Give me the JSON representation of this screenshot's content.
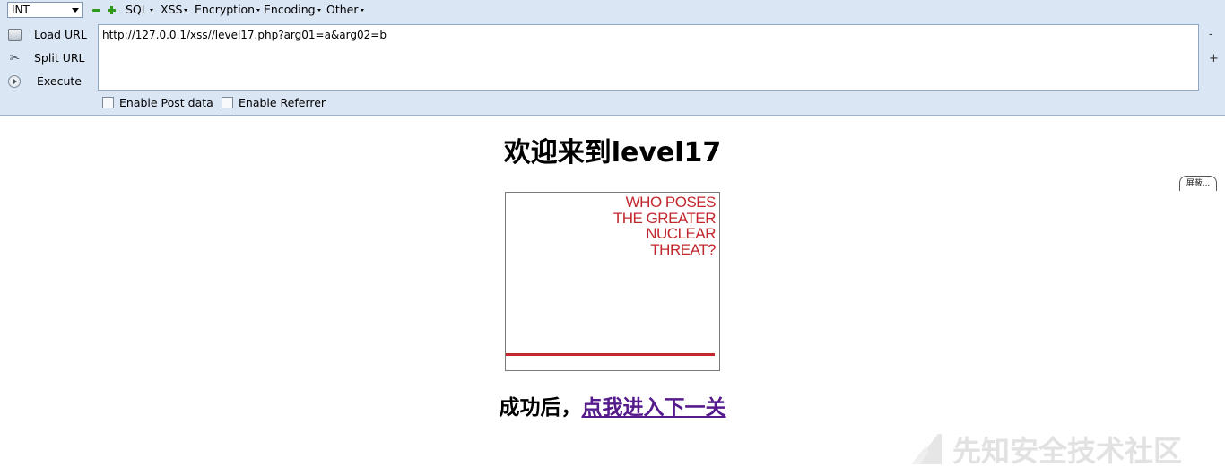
{
  "hackbar": {
    "int_select": "INT",
    "menus": [
      "SQL",
      "XSS",
      "Encryption",
      "Encoding",
      "Other"
    ],
    "load_url": "Load URL",
    "split_url": "Split URL",
    "execute": "Execute",
    "url": "http://127.0.0.1/xss//level17.php?arg01=a&arg02=b",
    "minus_mark": "-",
    "plus_mark": "+",
    "enable_post": "Enable Post data",
    "enable_referrer": "Enable Referrer"
  },
  "page": {
    "title": "欢迎来到level17",
    "embed_text": [
      "WHO POSES",
      "THE GREATER",
      "NUCLEAR",
      "THREAT?"
    ],
    "footer_prefix": "成功后，",
    "footer_link": "点我进入下一关",
    "side_tab": "屏蔽..."
  },
  "watermark": {
    "text": "先知安全技术社区"
  },
  "colors": {
    "toolbar_bg": "#dbe6f4",
    "embed_red": "#c1272d",
    "link_visited": "#551a8b"
  }
}
